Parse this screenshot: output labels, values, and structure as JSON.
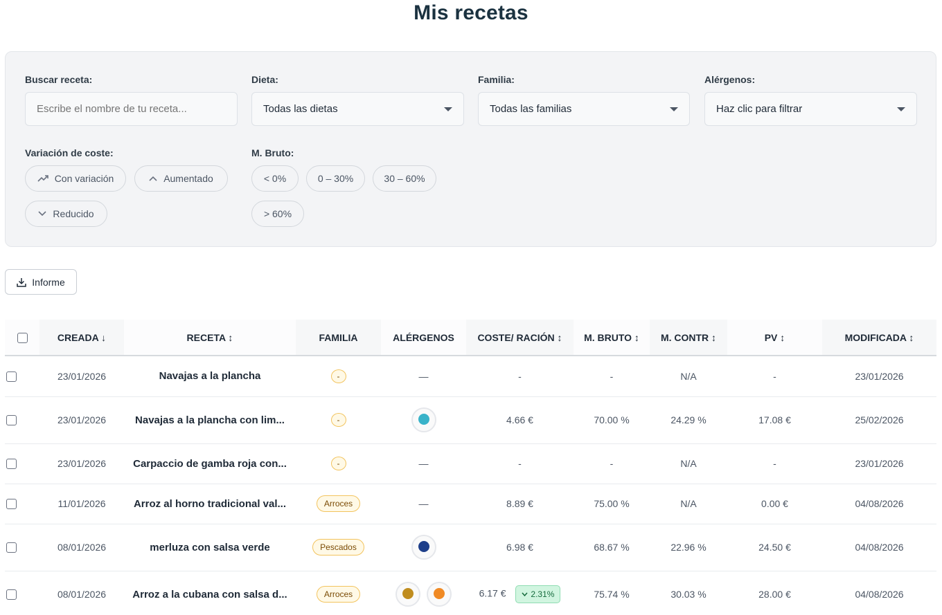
{
  "page": {
    "title": "Mis recetas"
  },
  "filters": {
    "search": {
      "label": "Buscar receta:",
      "placeholder": "Escribe el nombre de tu receta..."
    },
    "diet": {
      "label": "Dieta:",
      "value": "Todas las dietas"
    },
    "family": {
      "label": "Familia:",
      "value": "Todas las familias"
    },
    "allergens": {
      "label": "Alérgenos:",
      "value": "Haz clic para filtrar"
    },
    "cost_variation": {
      "label": "Variación de coste:",
      "chips": [
        "Con variación",
        "Aumentado",
        "Reducido"
      ]
    },
    "gross_margin": {
      "label": "M. Bruto:",
      "chips": [
        "< 0%",
        "0 – 30%",
        "30 – 60%",
        "> 60%"
      ]
    }
  },
  "toolbar": {
    "report_label": "Informe",
    "report_icon": "download-icon"
  },
  "table": {
    "headers": {
      "created": "CREADA ↓",
      "recipe": "RECETA ↕",
      "family": "FAMILIA",
      "allergens": "ALÉRGENOS",
      "cost": "COSTE/ RACIÓN ↕",
      "gross": "M. BRUTO ↕",
      "contr": "M. CONTR ↕",
      "pv": "PV ↕",
      "modified": "MODIFICADA ↕"
    },
    "rows": [
      {
        "created": "23/01/2026",
        "name": "Navajas a la plancha",
        "family": "-",
        "allergens": "—",
        "cost": "-",
        "variation": "",
        "gross": "-",
        "contr": "N/A",
        "pv": "-",
        "modified": "23/01/2026"
      },
      {
        "created": "23/01/2026",
        "name": "Navajas a la plancha con lim...",
        "family": "-",
        "allergens": "",
        "cost": "4.66 €",
        "variation": "",
        "gross": "70.00 %",
        "contr": "24.29 %",
        "pv": "17.08 €",
        "modified": "25/02/2026"
      },
      {
        "created": "23/01/2026",
        "name": "Carpaccio de gamba roja con...",
        "family": "-",
        "allergens": "—",
        "cost": "-",
        "variation": "",
        "gross": "-",
        "contr": "N/A",
        "pv": "-",
        "modified": "23/01/2026"
      },
      {
        "created": "11/01/2026",
        "name": "Arroz al horno tradicional val...",
        "family": "Arroces",
        "allergens": "—",
        "cost": "8.89 €",
        "variation": "",
        "gross": "75.00 %",
        "contr": "N/A",
        "pv": "0.00 €",
        "modified": "04/08/2026"
      },
      {
        "created": "08/01/2026",
        "name": "merluza con salsa verde",
        "family": "Pescados",
        "allergens": "",
        "cost": "6.98 €",
        "variation": "",
        "gross": "68.67 %",
        "contr": "22.96 %",
        "pv": "24.50 €",
        "modified": "04/08/2026"
      },
      {
        "created": "08/01/2026",
        "name": "Arroz a la cubana con salsa d...",
        "family": "Arroces",
        "allergens": "",
        "cost": "6.17 €",
        "variation": "2.31%",
        "gross": "75.74 %",
        "contr": "30.03 %",
        "pv": "28.00 €",
        "modified": "04/08/2026"
      }
    ],
    "allergen_icons": {
      "row2": [
        "mollusc-allergen-icon"
      ],
      "row5": [
        "fish-allergen-icon"
      ],
      "row6": [
        "cereal-allergen-icon",
        "egg-allergen-icon"
      ]
    }
  },
  "colors": {
    "accent_badge_border": "#f2c35d",
    "variation_down_bg": "#d1f5e0",
    "title": "#1b3240"
  }
}
